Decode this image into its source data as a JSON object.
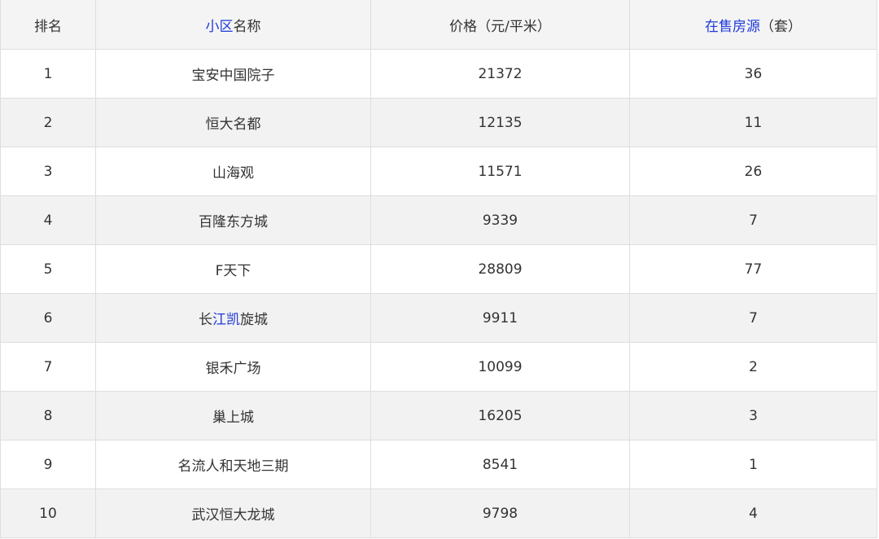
{
  "colors": {
    "text": "#333333",
    "link": "#1f3ad8",
    "header_bg": "#f4f4f4",
    "alt_bg": "#f2f2f2",
    "row_bg": "#ffffff",
    "border": "#dedede"
  },
  "table": {
    "headers": {
      "rank": "排名",
      "name": [
        {
          "text": "小区",
          "link": true
        },
        {
          "text": "名称",
          "link": false
        }
      ],
      "price": "价格（元/平米）",
      "listings": [
        {
          "text": "在售房源",
          "link": true
        },
        {
          "text": "（套）",
          "link": false
        }
      ]
    },
    "rows": [
      {
        "rank": "1",
        "name": [
          {
            "text": "宝安中国院子",
            "link": false
          }
        ],
        "price": "21372",
        "listings": "36"
      },
      {
        "rank": "2",
        "name": [
          {
            "text": "恒大名都",
            "link": false
          }
        ],
        "price": "12135",
        "listings": "11"
      },
      {
        "rank": "3",
        "name": [
          {
            "text": "山海观",
            "link": false
          }
        ],
        "price": "11571",
        "listings": "26"
      },
      {
        "rank": "4",
        "name": [
          {
            "text": "百隆东方城",
            "link": false
          }
        ],
        "price": "9339",
        "listings": "7"
      },
      {
        "rank": "5",
        "name": [
          {
            "text": "F天下",
            "link": false
          }
        ],
        "price": "28809",
        "listings": "77"
      },
      {
        "rank": "6",
        "name": [
          {
            "text": "长",
            "link": false
          },
          {
            "text": "江凯",
            "link": true
          },
          {
            "text": "旋城",
            "link": false
          }
        ],
        "price": "9911",
        "listings": "7"
      },
      {
        "rank": "7",
        "name": [
          {
            "text": "银禾广场",
            "link": false
          }
        ],
        "price": "10099",
        "listings": "2"
      },
      {
        "rank": "8",
        "name": [
          {
            "text": "巢上城",
            "link": false
          }
        ],
        "price": "16205",
        "listings": "3"
      },
      {
        "rank": "9",
        "name": [
          {
            "text": "名流人和天地三期",
            "link": false
          }
        ],
        "price": "8541",
        "listings": "1"
      },
      {
        "rank": "10",
        "name": [
          {
            "text": "武汉恒大龙城",
            "link": false
          }
        ],
        "price": "9798",
        "listings": "4"
      }
    ]
  }
}
